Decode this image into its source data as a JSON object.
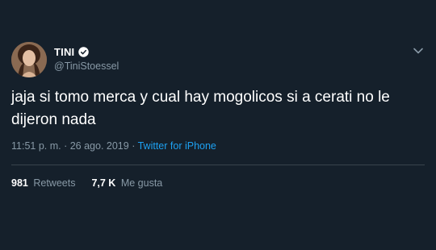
{
  "user": {
    "display_name": "TINI",
    "handle": "@TiniStoessel",
    "verified": true
  },
  "tweet": {
    "text": "jaja si tomo merca y cual hay mogolicos si a cerati no le dijeron nada",
    "time": "11:51 p. m.",
    "separator": " · ",
    "date": "26 ago. 2019",
    "source": "Twitter for iPhone"
  },
  "stats": {
    "retweets_count": "981",
    "retweets_label": "Retweets",
    "likes_count": "7,7 K",
    "likes_label": "Me gusta"
  },
  "icons": {
    "verified": "verified-badge-icon",
    "menu": "chevron-down-icon"
  },
  "colors": {
    "background": "#15202b",
    "text": "#ffffff",
    "muted": "#8899a6",
    "accent": "#1da1f2",
    "divider": "#38444d"
  }
}
